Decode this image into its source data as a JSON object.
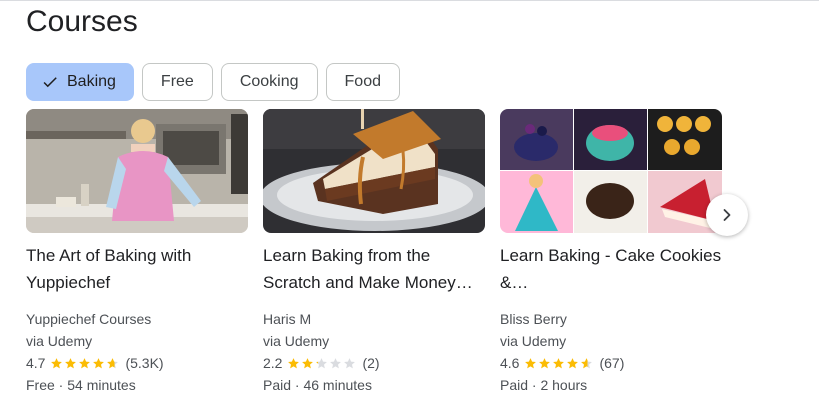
{
  "section": {
    "title": "Courses"
  },
  "filters": [
    {
      "label": "Baking",
      "selected": true
    },
    {
      "label": "Free",
      "selected": false
    },
    {
      "label": "Cooking",
      "selected": false
    },
    {
      "label": "Food",
      "selected": false
    }
  ],
  "courses": [
    {
      "title": "The Art of Baking with Yuppiechef",
      "author": "Yuppiechef Courses",
      "platform": "via Udemy",
      "rating": "4.7",
      "stars": 4.7,
      "reviews": "(5.3K)",
      "details": "Free · 54 minutes"
    },
    {
      "title": "Learn Baking from the Scratch and Make Money…",
      "author": "Haris M",
      "platform": "via Udemy",
      "rating": "2.2",
      "stars": 2.2,
      "reviews": "(2)",
      "details": "Paid · 46 minutes"
    },
    {
      "title": "Learn Baking - Cake Cookies &…",
      "author": "Bliss Berry",
      "platform": "via Udemy",
      "rating": "4.6",
      "stars": 4.6,
      "reviews": "(67)",
      "details": "Paid · 2 hours"
    }
  ],
  "colors": {
    "star": "#fbbc04",
    "star_empty": "#dadce0",
    "selected_chip": "#a8c7fa"
  },
  "icons": {
    "check": "check-icon",
    "next": "chevron-right-icon",
    "star": "star-icon"
  }
}
